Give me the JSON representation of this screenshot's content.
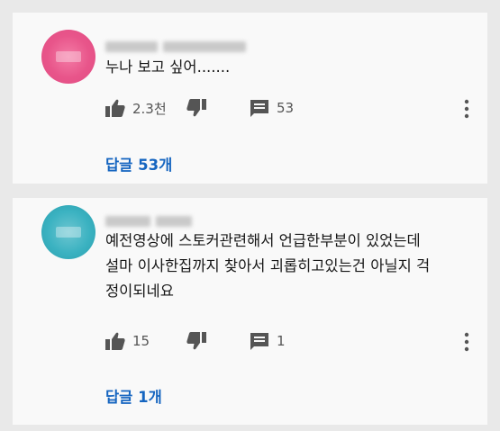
{
  "comments": [
    {
      "text_lines": [
        "누나 보고 싶어......."
      ],
      "like_count": "2.3천",
      "reply_count_icon": "53",
      "reply_link": "답글 53개",
      "avatar_color": "#e8558a",
      "icons": [
        "thumb-up-icon",
        "thumb-down-icon",
        "comment-icon",
        "more-vertical-icon"
      ]
    },
    {
      "text_lines": [
        "예전영상에 스토커관련해서 언급한부분이 있었는데",
        "설마 이사한집까지 찾아서 괴롭히고있는건 아닐지 걱",
        "정이되네요"
      ],
      "like_count": "15",
      "reply_count_icon": "1",
      "reply_link": "답글 1개",
      "avatar_color": "#3bb2c1",
      "icons": [
        "thumb-up-icon",
        "thumb-down-icon",
        "comment-icon",
        "more-vertical-icon"
      ]
    }
  ],
  "colors": {
    "link": "#1565c0",
    "icon": "#555555",
    "card_bg": "#f9f9f9",
    "page_bg": "#e9e9e9"
  }
}
